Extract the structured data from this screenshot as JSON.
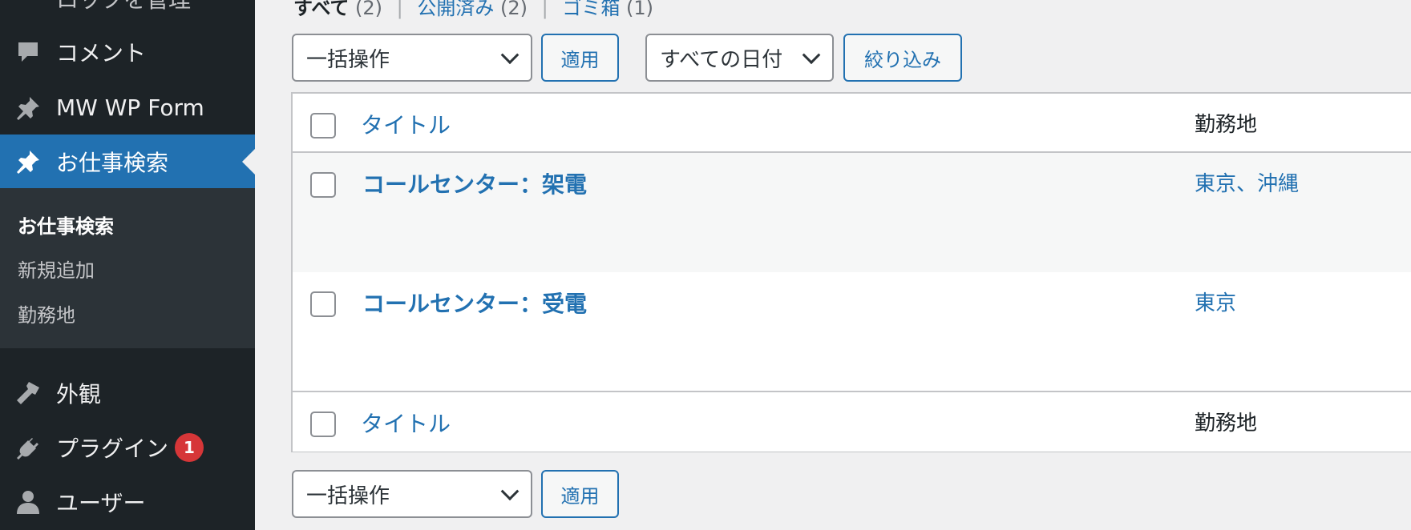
{
  "sidebar": {
    "items": [
      {
        "label": "ロックを管理",
        "icon": "lock-icon"
      },
      {
        "label": "コメント",
        "icon": "comment-icon"
      },
      {
        "label": "MW WP Form",
        "icon": "pin-icon"
      },
      {
        "label": "お仕事検索",
        "icon": "pin-icon",
        "current": true
      },
      {
        "label": "外観",
        "icon": "paintbrush-icon"
      },
      {
        "label": "プラグイン",
        "icon": "plugin-icon",
        "badge": "1"
      },
      {
        "label": "ユーザー",
        "icon": "user-icon"
      }
    ],
    "submenu": [
      {
        "label": "お仕事検索",
        "current": true
      },
      {
        "label": "新規追加"
      },
      {
        "label": "勤務地"
      }
    ]
  },
  "views": {
    "all_label": "すべて",
    "all_count": "(2)",
    "published_label": "公開済み",
    "published_count": "(2)",
    "trash_label": "ゴミ箱",
    "trash_count": "(1)",
    "separator": "|"
  },
  "toolbar": {
    "bulk_action": "一括操作",
    "apply": "適用",
    "date_filter": "すべての日付",
    "filter": "絞り込み"
  },
  "table": {
    "columns": {
      "title": "タイトル",
      "location": "勤務地"
    },
    "rows": [
      {
        "title": "コールセンター：架電",
        "locations": [
          "東京",
          "沖縄"
        ]
      },
      {
        "title": "コールセンター：受電",
        "locations": [
          "東京"
        ]
      }
    ],
    "location_separator": "、"
  },
  "colors": {
    "sidebar_bg": "#1d2327",
    "accent": "#2271b1",
    "badge": "#d63638"
  }
}
